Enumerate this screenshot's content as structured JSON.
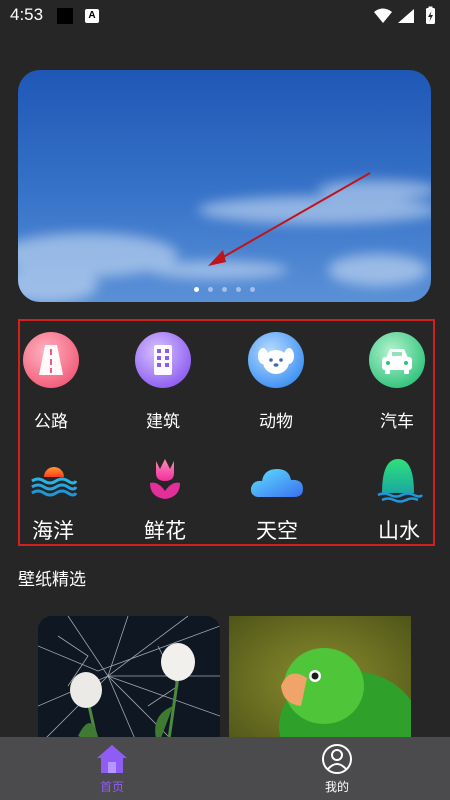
{
  "status_bar": {
    "time": "4:53",
    "a_badge": "A"
  },
  "banner": {
    "pages": 5,
    "active_page": 1
  },
  "categories": [
    {
      "label": "公路",
      "icon": "road-icon"
    },
    {
      "label": "建筑",
      "icon": "building-icon"
    },
    {
      "label": "动物",
      "icon": "dog-face-icon"
    },
    {
      "label": "汽车",
      "icon": "car-icon"
    },
    {
      "label": "海洋",
      "icon": "ocean-sunset-icon"
    },
    {
      "label": "鲜花",
      "icon": "tulip-icon"
    },
    {
      "label": "天空",
      "icon": "cloud-icon"
    },
    {
      "label": "山水",
      "icon": "mountain-water-icon"
    }
  ],
  "section": {
    "title": "壁纸精选"
  },
  "bottom_nav": [
    {
      "label": "首页",
      "icon": "home-icon",
      "active": true,
      "color": "#8f5cf6"
    },
    {
      "label": "我的",
      "icon": "user-icon",
      "active": false,
      "color": "#ffffff"
    }
  ]
}
